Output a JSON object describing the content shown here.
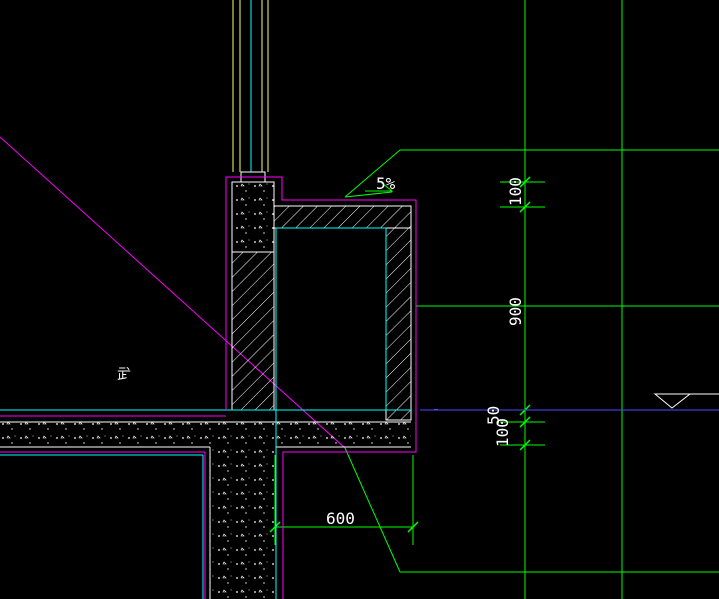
{
  "drawing": {
    "background_color": "#000000",
    "colors": {
      "structure_outline": "#ffffff",
      "finish_line": "#ff00ff",
      "inner_line": "#00ffff",
      "dimension_line": "#00ff00",
      "hatch": "#ffffff",
      "window_frame": "#ffff66",
      "level_line": "#4d4dff"
    },
    "annotations": {
      "slope": "5%",
      "room_label": "㱐"
    },
    "dimensions": {
      "horizontal": "600",
      "vertical": [
        "100",
        "900",
        "50",
        "100"
      ]
    },
    "symbols": {
      "level_marker": "triangle-level-icon"
    }
  }
}
